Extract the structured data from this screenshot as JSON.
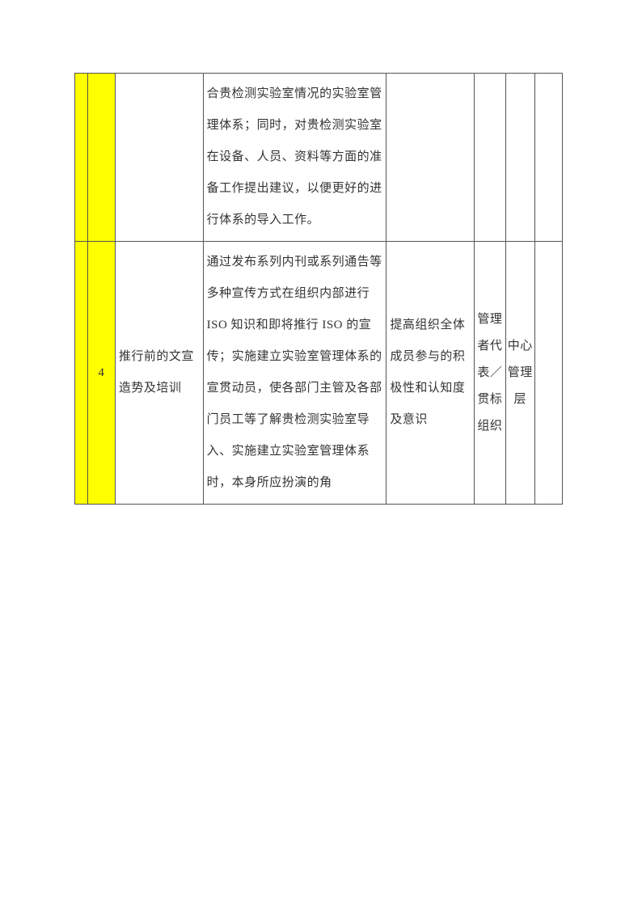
{
  "rows": [
    {
      "colA": "",
      "colB": "",
      "colC": "",
      "colD": "合贵检测实验室情况的实验室管理体系；同时，对贵检测实验室在设备、人员、资料等方面的准备工作提出建议，以便更好的进行体系的导入工作。",
      "colE": "",
      "colF": "",
      "colG": "",
      "colH": ""
    },
    {
      "colA": "",
      "colB": "4",
      "colC": "推行前的文宣\n造势及培训",
      "colD": "通过发布系列内刊或系列通告等多种宣传方式在组织内部进行 ISO 知识和即将推行 ISO 的宣传；实施建立实验室管理体系的宣贯动员，使各部门主管及各部门员工等了解贵检测实验室导入、实施建立实验室管理体系时，本身所应扮演的角",
      "colE": "提高组织全体成员参与的积极性和认知度及意识",
      "colF": "管理者代表／贯标组织",
      "colG": "中心管理层",
      "colH": ""
    }
  ]
}
